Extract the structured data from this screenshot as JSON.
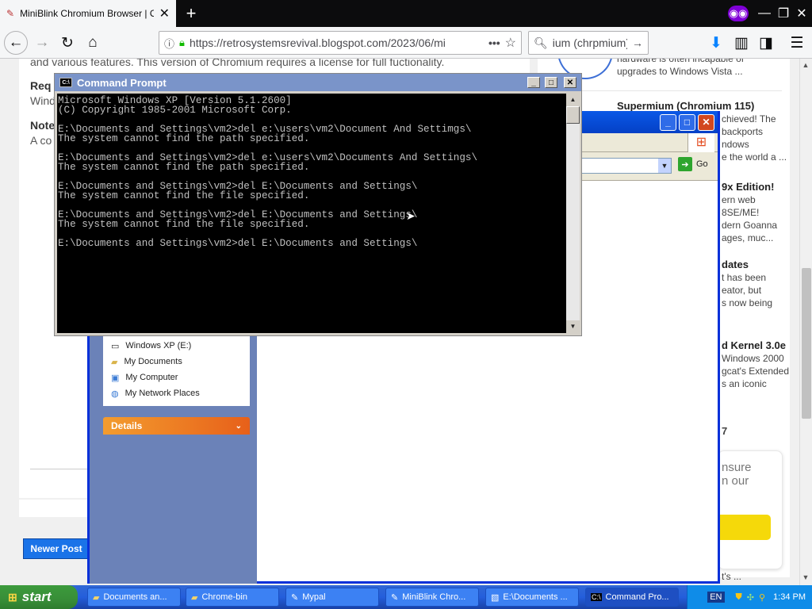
{
  "browser": {
    "tab_title": "MiniBlink Chromium Browser | Ope",
    "url": "https://retrosystemsrevival.blogspot.com/2023/06/mi",
    "search_text": "ium (chrpmium)"
  },
  "page": {
    "intro_text": "and various features. This version of Chromium requires a license for full fuctionality.",
    "req_label": "Req",
    "req_text": "Wind",
    "note_label": "Note",
    "note_text": "A co",
    "newer_post": "Newer Post",
    "side_top": "hardware is often incapable of upgrades to Windows Vista ...",
    "side_post1_title": "Supermium (Chromium 115)",
    "side_post1_l1": "chieved! The",
    "side_post1_l2": "backports",
    "side_post1_l3": "ndows",
    "side_post1_l4": "e the world a ...",
    "side_post2_title": "9x Edition!",
    "side_post2_l1": "ern web",
    "side_post2_l2": "8SE/ME!",
    "side_post2_l3": "dern Goanna",
    "side_post2_l4": "ages, muc...",
    "side_post3_title": "dates",
    "side_post3_l1": "t has been",
    "side_post3_l2": "eator, but",
    "side_post3_l3": "s now being",
    "side_post4_title": "d Kernel 3.0e",
    "side_post4_l1": "Windows 2000",
    "side_post4_l2": "gcat's Extended",
    "side_post4_l3": "s an iconic",
    "side_num": "7",
    "consent_l1": "nsure",
    "consent_l2": "n our",
    "side_bottom": "t's ..."
  },
  "explorer": {
    "go_label": "Go",
    "tasks": [
      "Windows XP (E:)",
      "My Documents",
      "My Computer",
      "My Network Places"
    ],
    "details_label": "Details"
  },
  "cmd": {
    "title": "Command Prompt",
    "lines": [
      "Microsoft Windows XP [Version 5.1.2600]",
      "(C) Copyright 1985-2001 Microsoft Corp.",
      "",
      "E:\\Documents and Settings\\vm2>del e:\\users\\vm2\\Document And Settimgs\\",
      "The system cannot find the path specified.",
      "",
      "E:\\Documents and Settings\\vm2>del e:\\users\\vm2\\Documents And Settings\\",
      "The system cannot find the path specified.",
      "",
      "E:\\Documents and Settings\\vm2>del E:\\Documents and Settings\\",
      "The system cannot find the file specified.",
      "",
      "E:\\Documents and Settings\\vm2>del E:\\Documents and Settings\\",
      "The system cannot find the file specified.",
      "",
      "E:\\Documents and Settings\\vm2>del E:\\Documents and Settings\\"
    ]
  },
  "taskbar": {
    "start_label": "start",
    "buttons": [
      "Documents an...",
      "Chrome-bin",
      "Mypal",
      "MiniBlink Chro...",
      "E:\\Documents ...",
      "Command Pro..."
    ],
    "lang": "EN",
    "time": "1:34 PM"
  },
  "colors": {
    "xp_blue": "#245edb",
    "start_green": "#388e38",
    "blogger_blue": "#1a73e8",
    "consent_yellow": "#f5d90a"
  }
}
